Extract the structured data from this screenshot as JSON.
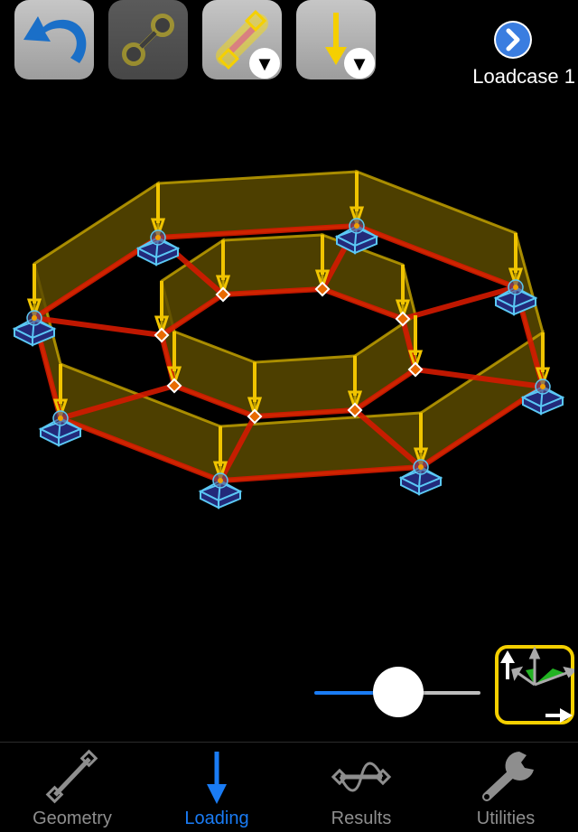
{
  "toolbar": {
    "buttons": [
      {
        "id": "undo",
        "icon": "undo-arrow-icon",
        "state": "enabled"
      },
      {
        "id": "add-member",
        "icon": "member-link-icon",
        "state": "disabled"
      },
      {
        "id": "select-member",
        "icon": "selected-member-icon",
        "state": "enabled",
        "has_dropdown": true
      },
      {
        "id": "point-load",
        "icon": "load-arrow-down-icon",
        "state": "enabled",
        "has_dropdown": true
      }
    ],
    "dropdown_glyph": "▼"
  },
  "loadcase": {
    "label": "Loadcase 1",
    "next_icon": "chevron-right-circle-icon"
  },
  "model": {
    "outer_nodes": 8,
    "inner_nodes": 8,
    "supports": "pinned",
    "load_direction": "down",
    "colors": {
      "member": "#d41a00",
      "panel_fill": "#5a4a00",
      "panel_edge": "#c9a800",
      "load_arrow": "#f0c400",
      "support": "#5bc8f5",
      "support_fill": "#232a7a"
    }
  },
  "slider": {
    "value": 0.45,
    "min_color": "#1a7cf5",
    "max_color": "#bdbdbd"
  },
  "view_axis_button": {
    "icon": "axis-triad-icon",
    "border_color": "#f5d000"
  },
  "tabs": [
    {
      "label": "Geometry",
      "icon": "member-icon",
      "active": false
    },
    {
      "label": "Loading",
      "icon": "arrow-down-icon",
      "active": true
    },
    {
      "label": "Results",
      "icon": "deflection-wave-icon",
      "active": false
    },
    {
      "label": "Utilities",
      "icon": "wrench-icon",
      "active": false
    }
  ],
  "accent_color": "#1a7cf5"
}
